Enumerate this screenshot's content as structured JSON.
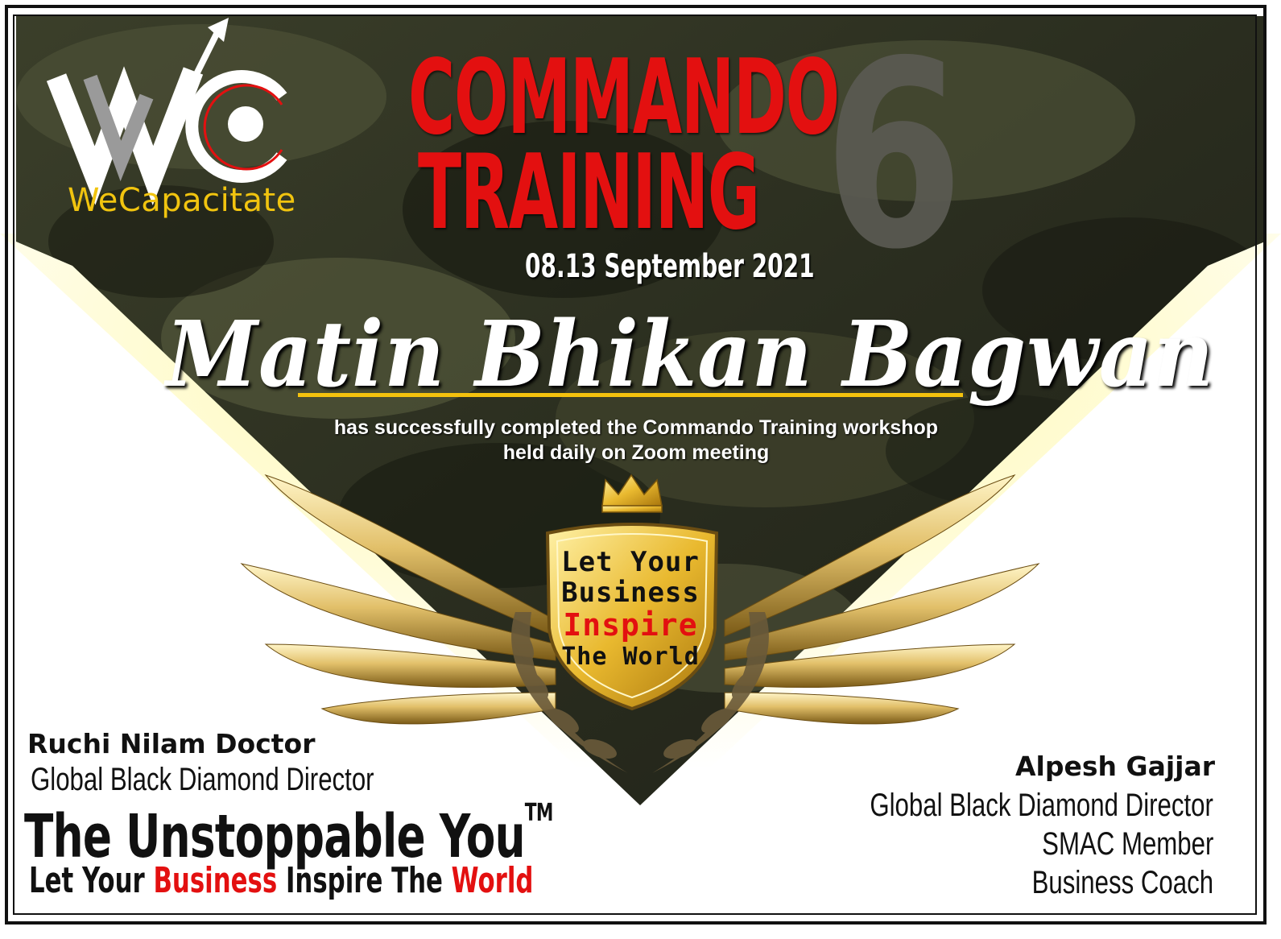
{
  "brand": {
    "name": "WeCapacitate",
    "logo_letters": "WC"
  },
  "title": {
    "line1": "Commando",
    "line2": "Training",
    "edition": "6",
    "date": "08.13 September 2021"
  },
  "recipient": {
    "name": "Matin Bhikan Bagwan"
  },
  "description": {
    "line1": "has successfully completed the Commando Training workshop",
    "line2": "held daily on Zoom meeting"
  },
  "badge": {
    "line1": "Let Your",
    "line2": "Business",
    "line3": "Inspire",
    "line4": "The World"
  },
  "signatory_left": {
    "name": "Ruchi Nilam Doctor",
    "title": "Global Black Diamond Director"
  },
  "slogan": {
    "main": "The Unstoppable You",
    "trademark": "TM",
    "tag_w1": "Let Your ",
    "tag_w2": "Business",
    "tag_w3": " Inspire The ",
    "tag_w4": "World"
  },
  "signatory_right": {
    "name": "Alpesh Gajjar",
    "title1": "Global Black Diamond Director",
    "title2": "SMAC Member",
    "title3": "Business Coach"
  },
  "colors": {
    "accent_red": "#e31010",
    "gold": "#f4c20d",
    "camo_dark": "#2a2e1e"
  }
}
